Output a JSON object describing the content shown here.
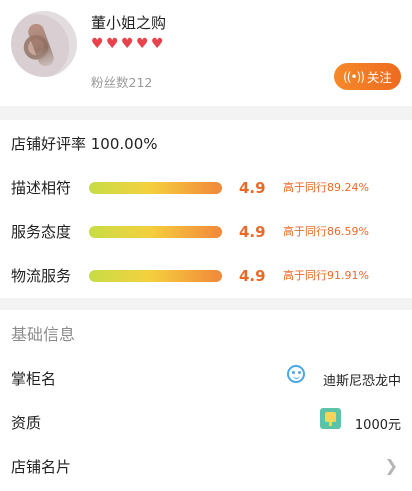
{
  "shop": {
    "name": "董小姐之购",
    "hearts": 5,
    "fans_label": "粉丝数212",
    "follow_label": "关注",
    "follow_icon": "signal-icon"
  },
  "ratings": {
    "overall_label": "店铺好评率 100.00%",
    "items": [
      {
        "label": "描述相符",
        "score": "4.9",
        "compare": "高于同行89.24%"
      },
      {
        "label": "服务态度",
        "score": "4.9",
        "compare": "高于同行86.59%"
      },
      {
        "label": "物流服务",
        "score": "4.9",
        "compare": "高于同行91.91%"
      }
    ]
  },
  "basic_info": {
    "title": "基础信息",
    "keeper_label": "掌柜名",
    "keeper_value": "迪斯尼恐龙中",
    "deposit_label": "资质",
    "deposit_value": "1000元",
    "card_label": "店铺名片"
  },
  "colors": {
    "accent": "#ee6a1f",
    "heart": "#e8434d",
    "bar_start": "#c7dd45",
    "bar_end": "#f2883a"
  }
}
